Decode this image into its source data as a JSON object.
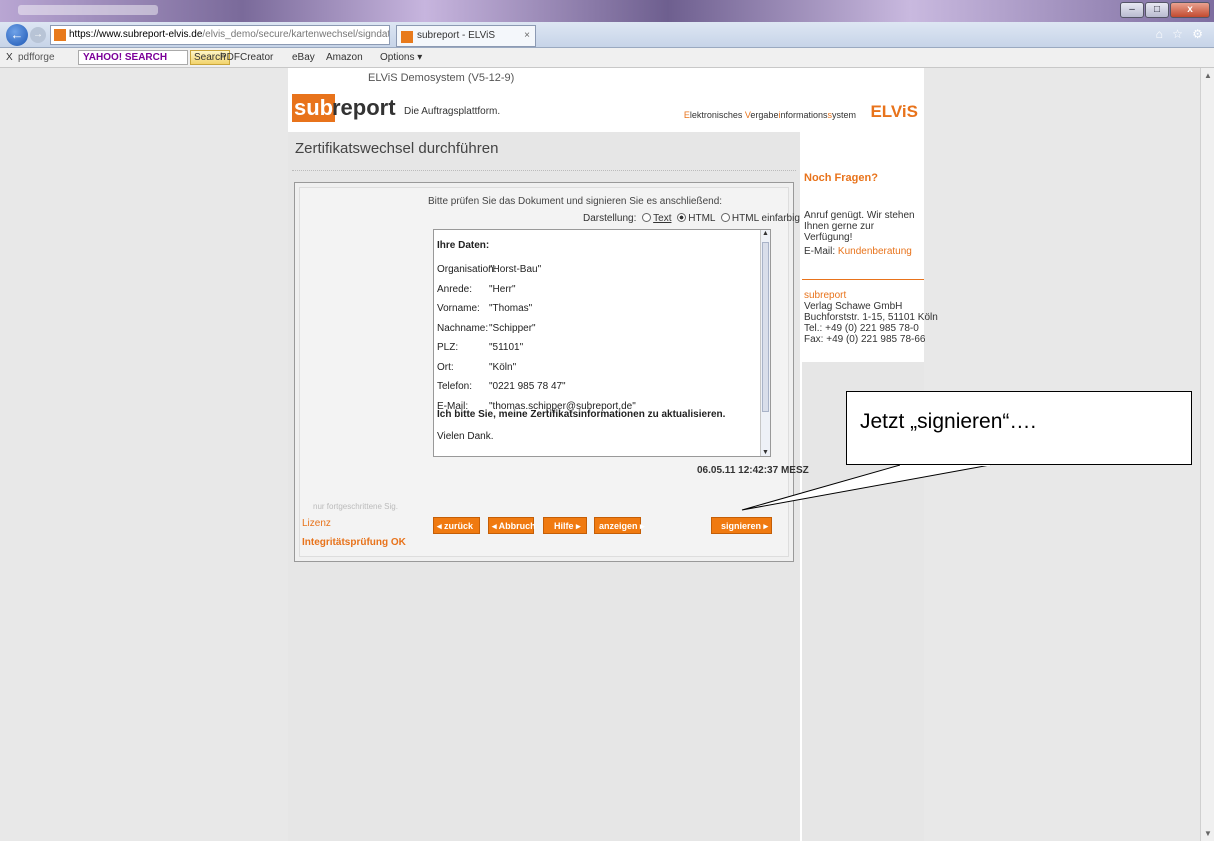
{
  "browser": {
    "url_host": "https://www.subreport-elvis.de",
    "url_path": "/elvis_demo/secure/kartenwechsel/signdata.pl",
    "address_tools": "ρ ▾ 🔒 ☐ C ✕",
    "tab_title": "subreport - ELViS",
    "tab_close": "×",
    "back_icon": "back-arrow-icon",
    "min_label": "–",
    "max_label": "□",
    "close_label": "x"
  },
  "toolbar": {
    "close": "X",
    "pdfforge": "pdfforge",
    "yahoo": "YAHOO! SEARCH",
    "search": "Search",
    "pdfcreator": "PDFCreator",
    "ebay": "eBay",
    "amazon": "Amazon",
    "options": "Options ▾"
  },
  "site": {
    "demo_title": "ELViS Demosystem (V5-12-9)",
    "logo_sub": "sub",
    "logo_report": "report",
    "tagline": "Die Auftragsplattform.",
    "elvis_caption_E": "E",
    "elvis_caption_1": "lektronisches ",
    "elvis_caption_V": "V",
    "elvis_caption_2": "ergabe",
    "elvis_caption_i": "i",
    "elvis_caption_3": "nformations",
    "elvis_caption_s": "s",
    "elvis_caption_4": "ystem",
    "elvis_logo": "ELViS"
  },
  "page": {
    "title": "Zertifikatswechsel durchführen",
    "instruction": "Bitte prüfen Sie das Dokument und signieren Sie es anschließend:",
    "display_label": "Darstellung:",
    "display_options": [
      "Text",
      "HTML",
      "HTML einfarbig"
    ],
    "display_selected": "HTML",
    "timestamp": "06.05.11 12:42:37 MESZ",
    "sig_note": "nur fortgeschrittene Sig.",
    "lizenz": "Lizenz",
    "integritaet": "Integritätsprüfung OK"
  },
  "document": {
    "heading": "Ihre Daten:",
    "fields": [
      {
        "label": "Organisation:",
        "value": "\"Horst-Bau\""
      },
      {
        "label": "Anrede:",
        "value": "\"Herr\""
      },
      {
        "label": "Vorname:",
        "value": "\"Thomas\""
      },
      {
        "label": "Nachname:",
        "value": "\"Schipper\""
      },
      {
        "label": "PLZ:",
        "value": "\"51101\""
      },
      {
        "label": "Ort:",
        "value": "\"Köln\""
      },
      {
        "label": "Telefon:",
        "value": "\"0221 985 78 47\""
      },
      {
        "label": "E-Mail:",
        "value": "\"thomas.schipper@subreport.de\""
      }
    ],
    "request": "Ich bitte Sie, meine Zertifikatsinformationen zu aktualisieren.",
    "thanks": "Vielen Dank."
  },
  "buttons": {
    "zurueck": "◂ zurück",
    "abbruch": "◂ Abbruch",
    "hilfe": "Hilfe ▸",
    "anzeigen": "anzeigen ▸",
    "signieren": "signieren ▸"
  },
  "info": {
    "heading": "Noch Fragen?",
    "call": "Anruf genügt. Wir stehen Ihnen gerne zur Verfügung!",
    "email_label": "E-Mail:",
    "email_link": "Kundenberatung",
    "brand": "subreport",
    "address_lines": [
      "Verlag Schawe GmbH",
      "Buchforststr. 1-15, 51101 Köln",
      "Tel.: +49 (0) 221 985 78-0",
      "Fax: +49 (0) 221 985 78-66"
    ]
  },
  "annotation": {
    "text": "Jetzt „signieren“…."
  },
  "colors": {
    "accent": "#e8731b",
    "button": "#f07a10"
  }
}
